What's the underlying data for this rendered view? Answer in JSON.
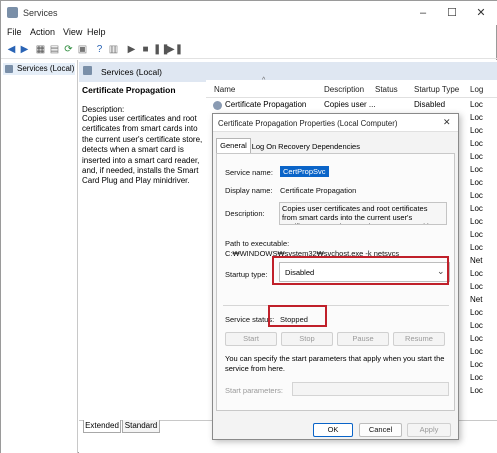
{
  "window": {
    "title": "Services"
  },
  "menu": [
    "File",
    "Action",
    "View",
    "Help"
  ],
  "tree": {
    "root": "Services (Local)"
  },
  "main": {
    "header": "Services (Local)",
    "service_name": "Certificate Propagation",
    "description_label": "Description:",
    "description": "Copies user certificates and root certificates from smart cards into the current user's certificate store, detects when a smart card is inserted into a smart card reader, and, if needed, installs the Smart Card Plug and Play minidriver.",
    "columns": [
      "Name",
      "Description",
      "Status",
      "Startup Type",
      "Log"
    ],
    "rows": [
      {
        "name": "Certificate Propagation",
        "description": "Copies user ...",
        "status": "",
        "startup": "Disabled",
        "log": "Loc"
      },
      {
        "log": "Loc"
      },
      {
        "log": "Loc"
      },
      {
        "log": "Loc"
      },
      {
        "log": "Loc"
      },
      {
        "log": "Loc"
      },
      {
        "log": "Loc"
      },
      {
        "log": "Loc"
      },
      {
        "log": "Loc"
      },
      {
        "log": "Loc"
      },
      {
        "log": "Loc"
      },
      {
        "log": "Loc"
      },
      {
        "log": "Net"
      },
      {
        "log": "Loc"
      },
      {
        "log": "Loc"
      },
      {
        "log": "Net"
      },
      {
        "log": "Loc"
      },
      {
        "log": "Loc"
      },
      {
        "log": "Loc"
      },
      {
        "log": "Loc"
      },
      {
        "log": "Loc"
      },
      {
        "log": "Loc"
      },
      {
        "log": "Loc"
      }
    ],
    "tabs": [
      "Extended",
      "Standard"
    ]
  },
  "dialog": {
    "title": "Certificate Propagation Properties (Local Computer)",
    "tabs": [
      "General",
      "Log On",
      "Recovery",
      "Dependencies"
    ],
    "service_name_label": "Service name:",
    "service_name": "CertPropSvc",
    "display_name_label": "Display name:",
    "display_name": "Certificate Propagation",
    "description_label": "Description:",
    "description": "Copies user certificates and root certificates from smart cards into the current user's certificate store, detects when a smart card is inserted into a smart",
    "path_label": "Path to executable:",
    "path": "C:\\WINDOWS\\system32\\svchost.exe -k netsvcs",
    "path_display": "C:₩WINDOWS₩system32₩svchost.exe -k netsvcs",
    "startup_type_label": "Startup type:",
    "startup_type": "Disabled",
    "service_status_label": "Service status:",
    "service_status": "Stopped",
    "buttons": {
      "start": "Start",
      "stop": "Stop",
      "pause": "Pause",
      "resume": "Resume"
    },
    "help_text": "You can specify the start parameters that apply when you start the service from here.",
    "start_params_label": "Start parameters:",
    "ok": "OK",
    "cancel": "Cancel",
    "apply": "Apply"
  },
  "colors": {
    "highlight_border": "#c0202a",
    "selection": "#0a64c8",
    "header_bg": "#dfe7f2"
  }
}
